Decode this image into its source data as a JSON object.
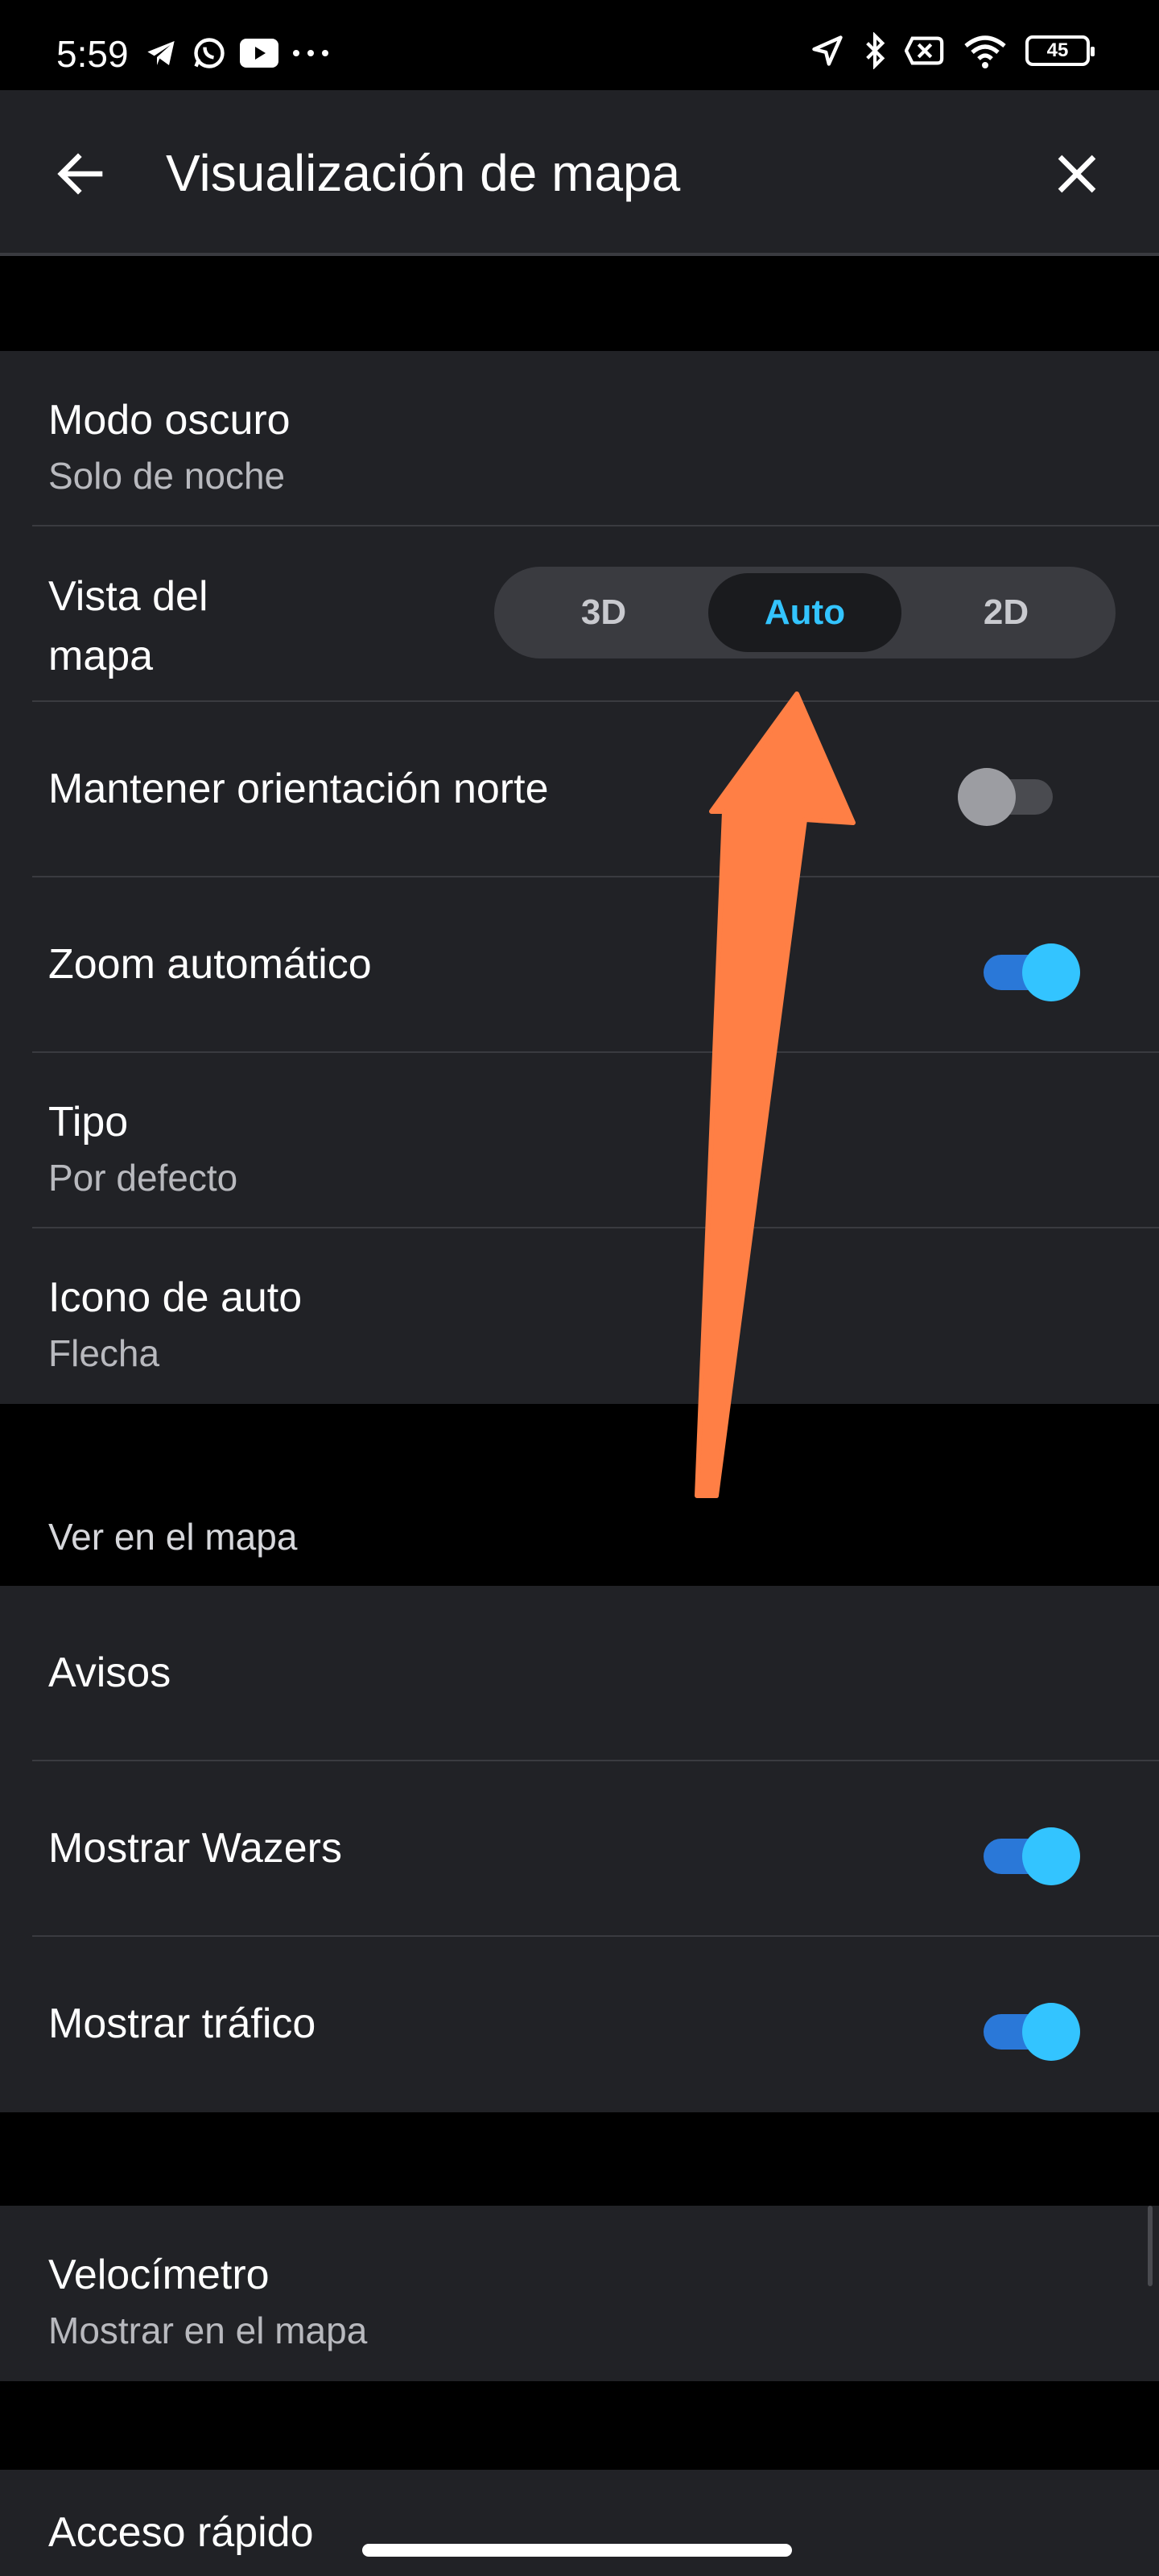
{
  "status_bar": {
    "time": "5:59",
    "left_icons": [
      "telegram-icon",
      "whatsapp-icon",
      "youtube-icon",
      "more-dots-icon"
    ],
    "right_icons": [
      "location-arrow-icon",
      "bluetooth-icon",
      "sim-off-icon",
      "wifi-icon"
    ],
    "battery": "45"
  },
  "app_bar": {
    "title": "Visualización de mapa",
    "back_icon": "arrow-back-icon",
    "close_icon": "close-icon"
  },
  "settings_group_1": {
    "dark_mode": {
      "label": "Modo oscuro",
      "value": "Solo de noche"
    },
    "map_view": {
      "label": "Vista del mapa",
      "options": [
        "3D",
        "Auto",
        "2D"
      ],
      "selected": "Auto"
    },
    "keep_north": {
      "label": "Mantener orientación norte",
      "enabled": false
    },
    "auto_zoom": {
      "label": "Zoom automático",
      "enabled": true
    },
    "type": {
      "label": "Tipo",
      "value": "Por defecto"
    },
    "car_icon": {
      "label": "Icono de auto",
      "value": "Flecha"
    }
  },
  "section_see_on_map": {
    "header": "Ver en el mapa",
    "reports": {
      "label": "Avisos"
    },
    "show_wazers": {
      "label": "Mostrar Wazers",
      "enabled": true
    },
    "show_traffic": {
      "label": "Mostrar tráfico",
      "enabled": true
    }
  },
  "settings_group_3": {
    "speedometer": {
      "label": "Velocímetro",
      "value": "Mostrar en el mapa"
    },
    "quick_access": {
      "label": "Acceso rápido"
    }
  },
  "annotation": {
    "arrow_color": "#ff7f45"
  },
  "colors": {
    "background": "#000000",
    "surface": "#212226",
    "accent": "#33c4ff",
    "toggle_track_on": "#2a78d8"
  }
}
